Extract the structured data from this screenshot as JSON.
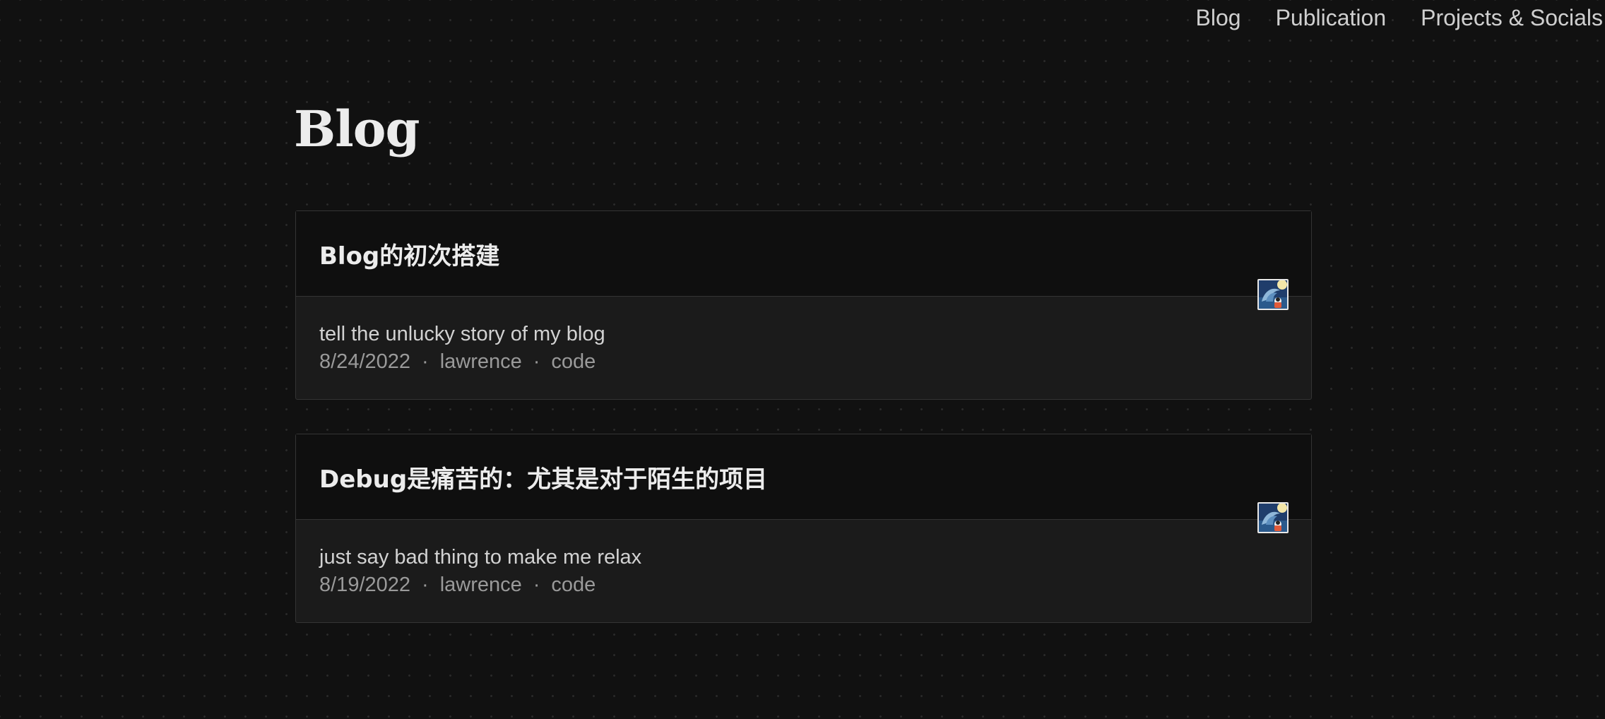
{
  "nav": {
    "items": [
      {
        "label": "Blog"
      },
      {
        "label": "Publication"
      },
      {
        "label": "Projects & Socials"
      }
    ]
  },
  "page": {
    "title": "Blog"
  },
  "posts": [
    {
      "title": "Blog的初次搭建",
      "description": "tell the unlucky story of my blog",
      "date": "8/24/2022",
      "author": "lawrence",
      "tag": "code",
      "separator": "·"
    },
    {
      "title": "Debug是痛苦的：尤其是对于陌生的项目",
      "description": "just say bad thing to make me relax",
      "date": "8/19/2022",
      "author": "lawrence",
      "tag": "code",
      "separator": "·"
    }
  ],
  "colors": {
    "background": "#111111",
    "card_header": "#0f0f0f",
    "card_body": "#1b1b1b",
    "border": "#343434",
    "text_primary": "#ececec",
    "text_muted": "#9a9a9a"
  },
  "icons": {
    "avatar": "avatar-image"
  }
}
